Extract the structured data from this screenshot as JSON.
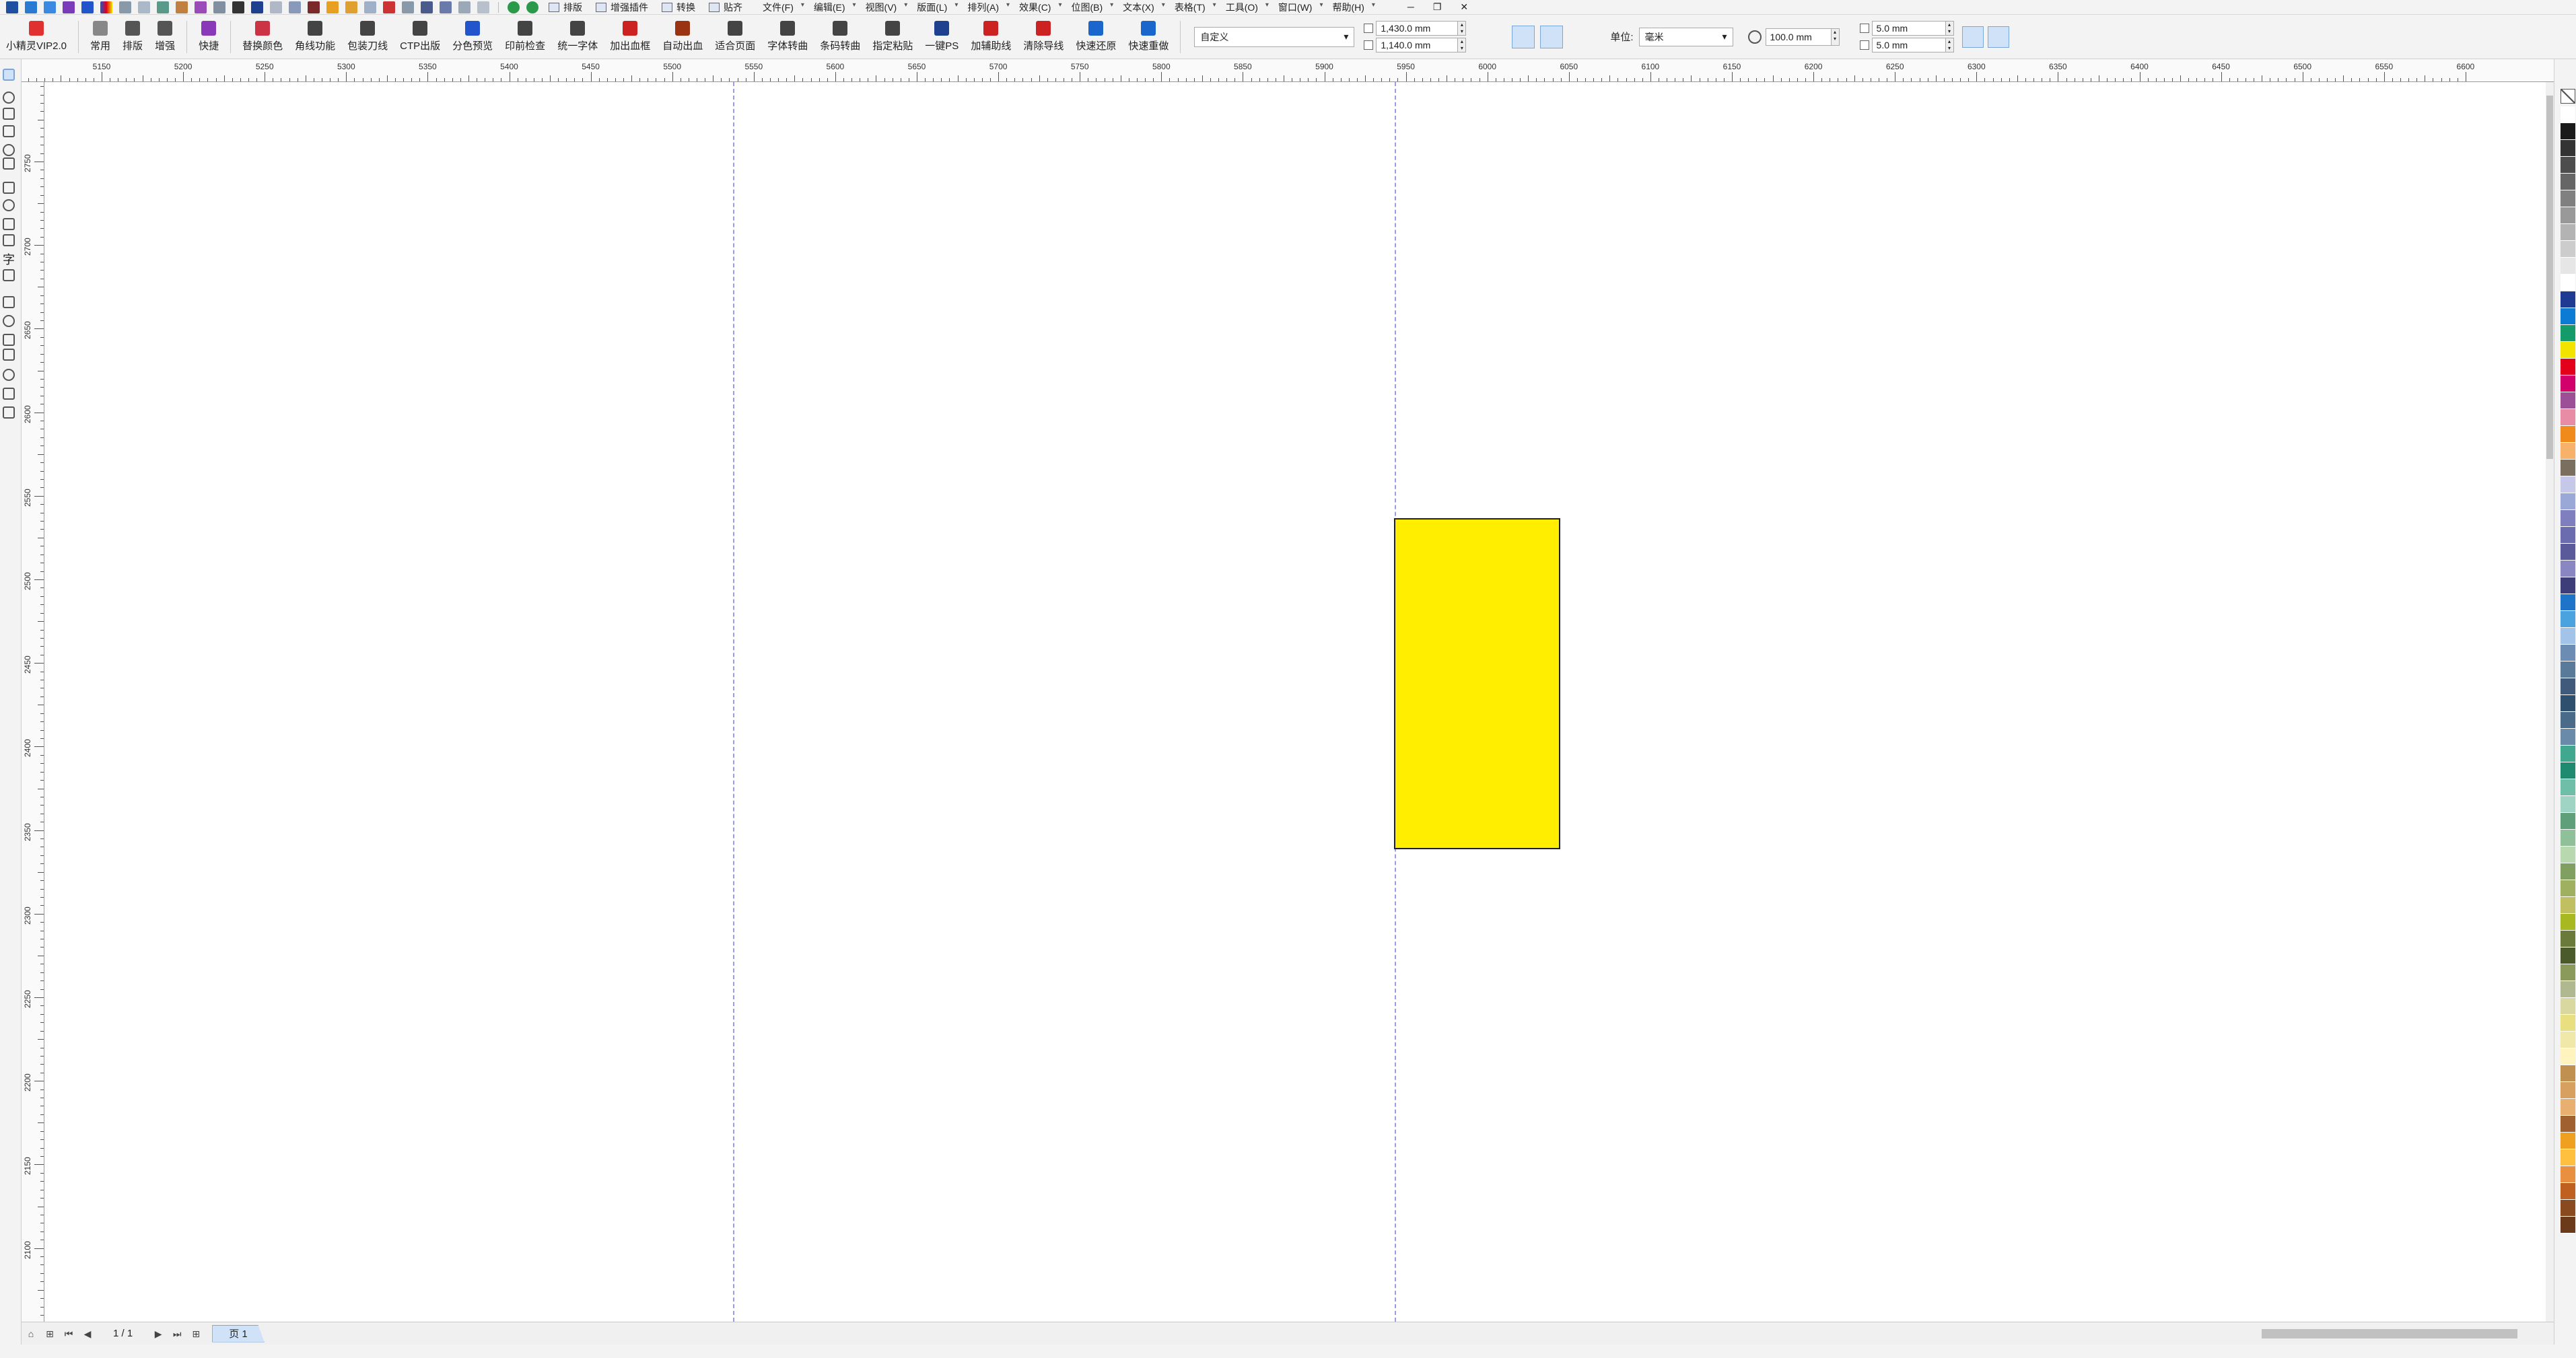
{
  "menubar": {
    "buttons": [
      {
        "label": "排版",
        "icon": "layout-icon"
      },
      {
        "label": "增强插件",
        "icon": "plugin-icon"
      },
      {
        "label": "转换",
        "icon": "convert-icon"
      },
      {
        "label": "贴齐",
        "icon": "snap-icon"
      }
    ],
    "menus": [
      "文件(F)",
      "编辑(E)",
      "视图(V)",
      "版面(L)",
      "排列(A)",
      "效果(C)",
      "位图(B)",
      "文本(X)",
      "表格(T)",
      "工具(O)",
      "窗口(W)",
      "帮助(H)"
    ],
    "window_controls": [
      "─",
      "❐",
      "✕"
    ]
  },
  "toolbar": {
    "buttons": [
      {
        "label": "小精灵VIP2.0",
        "icon": "vip-logo-icon",
        "color": "#e03030"
      },
      {
        "label": "常用",
        "icon": "common-icon",
        "color": "#888888"
      },
      {
        "label": "排版",
        "icon": "layout-icon",
        "color": "#555555"
      },
      {
        "label": "增强",
        "icon": "enhance-icon",
        "color": "#555555"
      },
      {
        "label": "快捷",
        "icon": "shortcut-icon",
        "color": "#8a3ab9"
      },
      {
        "label": "替换颜色",
        "icon": "replace-color-icon",
        "color": "#cc3344"
      },
      {
        "label": "角线功能",
        "icon": "corner-line-icon",
        "color": "#444444"
      },
      {
        "label": "包装刀线",
        "icon": "die-line-icon",
        "color": "#444444"
      },
      {
        "label": "CTP出版",
        "icon": "ctp-icon",
        "color": "#444444"
      },
      {
        "label": "分色预览",
        "icon": "separation-icon",
        "color": "#2255cc"
      },
      {
        "label": "印前检查",
        "icon": "preflight-icon",
        "color": "#444444"
      },
      {
        "label": "统一字体",
        "icon": "font-unify-icon",
        "color": "#444444"
      },
      {
        "label": "加出血框",
        "icon": "bleed-box-icon",
        "color": "#cc2222"
      },
      {
        "label": "自动出血",
        "icon": "auto-bleed-icon",
        "color": "#993311"
      },
      {
        "label": "适合页面",
        "icon": "fit-page-icon",
        "color": "#444444"
      },
      {
        "label": "字体转曲",
        "icon": "text-to-curve-icon",
        "color": "#444444"
      },
      {
        "label": "条码转曲",
        "icon": "barcode-icon",
        "color": "#444444"
      },
      {
        "label": "指定粘贴",
        "icon": "paste-special-icon",
        "color": "#444444"
      },
      {
        "label": "一键PS",
        "icon": "photoshop-icon",
        "color": "#1f3f8f"
      },
      {
        "label": "加辅助线",
        "icon": "add-guide-icon",
        "color": "#cc2222"
      },
      {
        "label": "清除导线",
        "icon": "clear-guide-icon",
        "color": "#cc2222"
      },
      {
        "label": "快速还原",
        "icon": "undo-icon",
        "color": "#1a66cc"
      },
      {
        "label": "快速重做",
        "icon": "redo-icon",
        "color": "#1a66cc"
      }
    ],
    "page_preset": "自定义",
    "width": "1,430.0 mm",
    "height": "1,140.0 mm",
    "units_label": "单位:",
    "units_value": "毫米",
    "nudge": "100.0 mm",
    "dup_x": "5.0 mm",
    "dup_y": "5.0 mm"
  },
  "ruler": {
    "h_labels": [
      "5150",
      "5200",
      "5250",
      "5300",
      "5350",
      "5400",
      "5450",
      "5500",
      "5550",
      "5600",
      "5650",
      "5700",
      "5750",
      "5800",
      "5850",
      "5900",
      "5950",
      "6000",
      "6050",
      "6100",
      "6150",
      "6200",
      "6250",
      "6300",
      "6350",
      "6400",
      "6450",
      "6500",
      "6550",
      "6600"
    ],
    "v_labels": [
      "2750",
      "2700",
      "2650",
      "2600",
      "2550",
      "2500",
      "2450",
      "2400",
      "2350",
      "2300",
      "2250",
      "2200",
      "2150",
      "2100"
    ]
  },
  "canvas": {
    "rect_fill": "#ffee00",
    "guide_color": "#9b9be6"
  },
  "palette": [
    "#ffffff",
    "#1a1a1a",
    "#333333",
    "#4d4d4d",
    "#666666",
    "#808080",
    "#999999",
    "#b3b3b3",
    "#cccccc",
    "#e6e6e6",
    "#ffffff",
    "#1f3a93",
    "#0b7bd4",
    "#159a6a",
    "#f2e400",
    "#e2001a",
    "#d1006a",
    "#9c4f96",
    "#e88ca5",
    "#f08a1c",
    "#f6b26b",
    "#7a6e5f",
    "#c5c8e8",
    "#9aa8d8",
    "#7f7fbf",
    "#6b6bb0",
    "#5a5a9a",
    "#8a86c1",
    "#3d3d7a",
    "#1e74c8",
    "#4aa3df",
    "#a3c4e8",
    "#6d8cb3",
    "#5a7a9a",
    "#3f5a7a",
    "#2f4f6f",
    "#4a6a8a",
    "#6a8aaa",
    "#3fa88f",
    "#1f8a6f",
    "#6fbfa8",
    "#9fd4c4",
    "#5fa07a",
    "#8fc09a",
    "#b8d8b0",
    "#7fa060",
    "#9fb060",
    "#c0c060",
    "#a8b820",
    "#6a7a3a",
    "#4a5a2a",
    "#8a9a5a",
    "#b0b890",
    "#d8d8a0",
    "#e8e080",
    "#f0e8a8",
    "#fff4c0",
    "#c09050",
    "#d8a060",
    "#e8b070",
    "#a06030",
    "#f0a020",
    "#ffc040",
    "#e89040",
    "#c06020",
    "#8a4a20",
    "#6a3a1a"
  ],
  "pagebar": {
    "page_count": "1 / 1",
    "page_tab": "页 1"
  }
}
